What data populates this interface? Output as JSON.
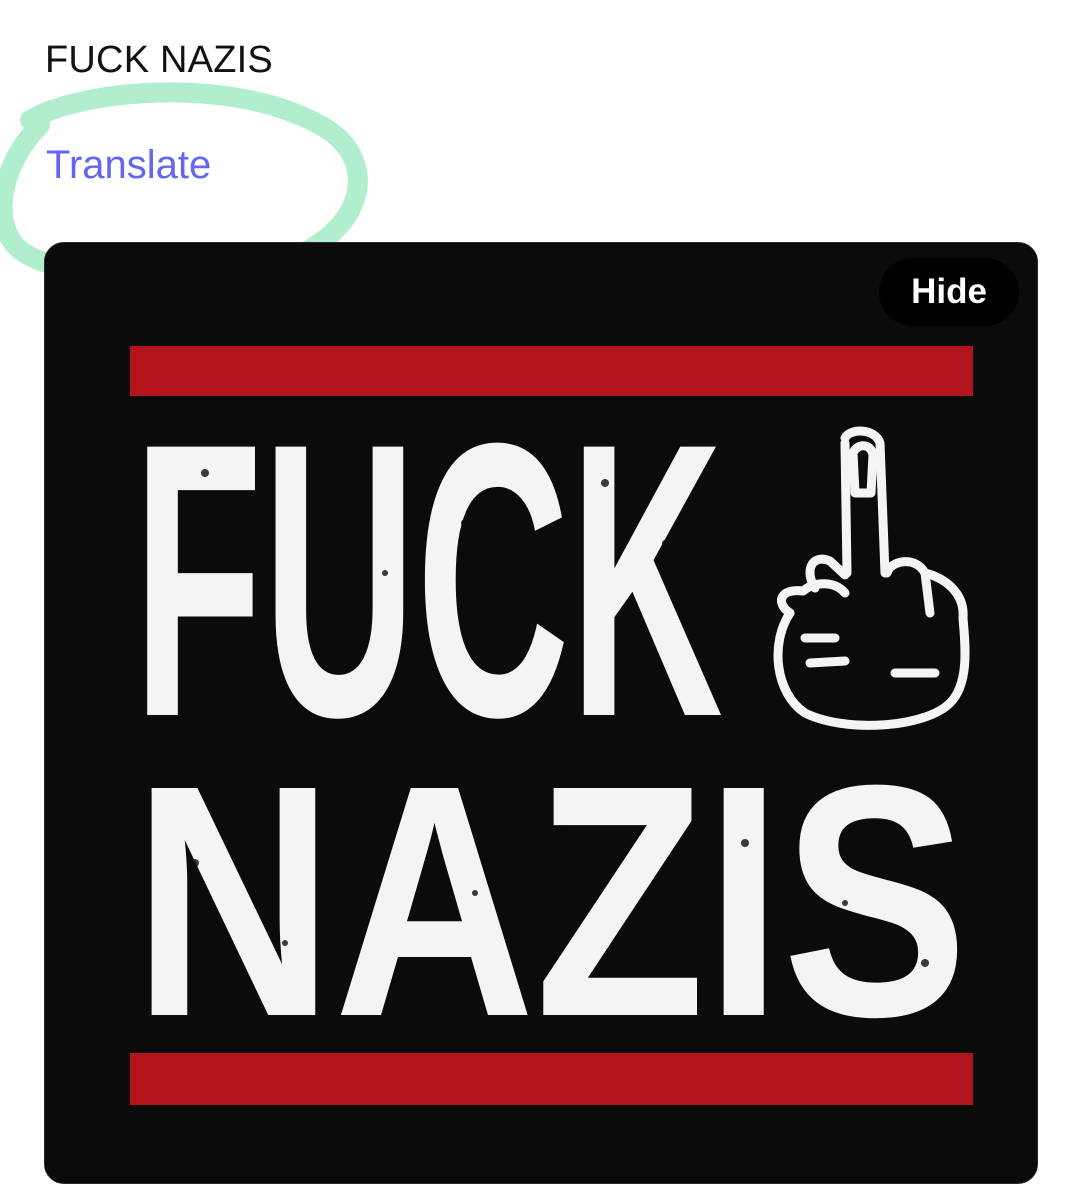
{
  "post": {
    "text": "FUCK NAZIS",
    "translate_label": "Translate"
  },
  "media": {
    "hide_label": "Hide",
    "poster": {
      "line1": "FUCK",
      "line2": "NAZIS",
      "icon": "middle-finger-icon"
    }
  },
  "colors": {
    "link": "#6366f1",
    "highlight": "#a8ecc8",
    "poster_background": "#0b0b0b",
    "poster_bar": "#b3141b",
    "poster_text": "#f4f4f4"
  }
}
